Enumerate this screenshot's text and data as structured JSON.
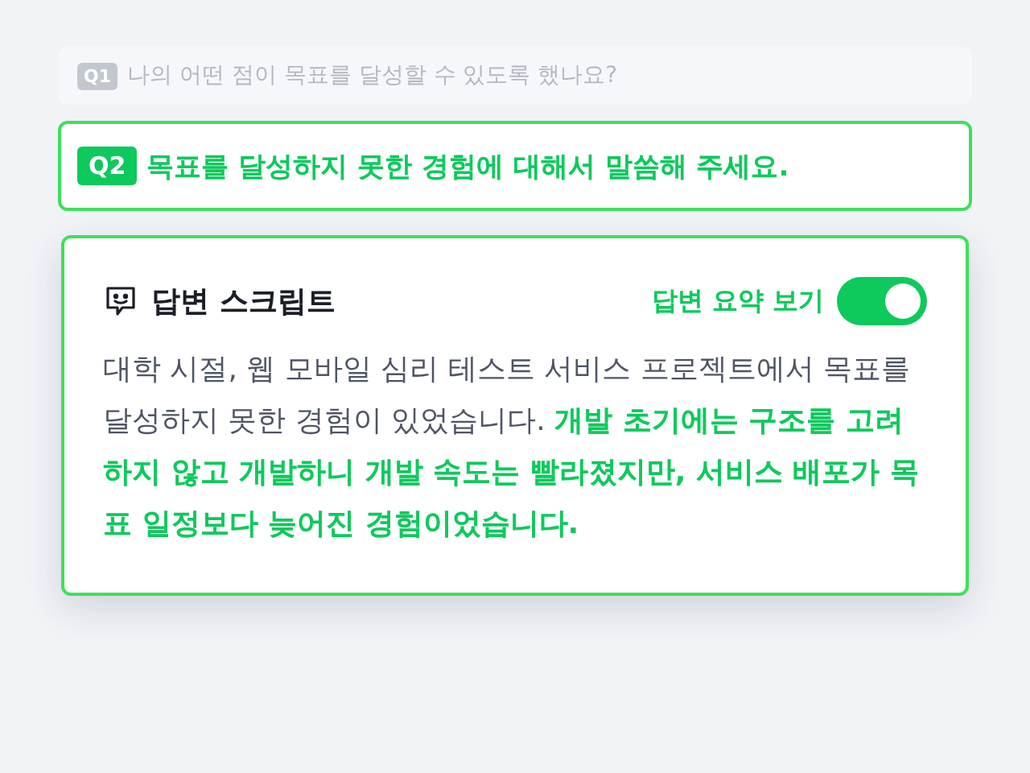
{
  "questions": [
    {
      "badge": "Q1",
      "text": "나의 어떤 점이 목표를 달성할 수 있도록 했나요?",
      "selected": false
    },
    {
      "badge": "Q2",
      "text": "목표를 달성하지 못한 경험에 대해서 말씀해 주세요.",
      "selected": true
    }
  ],
  "script_card": {
    "title": "답변 스크립트",
    "toggle": {
      "label": "답변 요약 보기",
      "on": true
    },
    "body": "대학 시절, 웹 모바일 심리 테스트 서비스 프로젝트에서 목표를 달성하지 못한 경험이 있었습니다. **개발 초기에는 구조를 고려하지 않고 개발하니 개발 속도는 빨라졌지만, 서비스 배포가 목표 일정보다 늦어진 경험이었습니다.**"
  }
}
